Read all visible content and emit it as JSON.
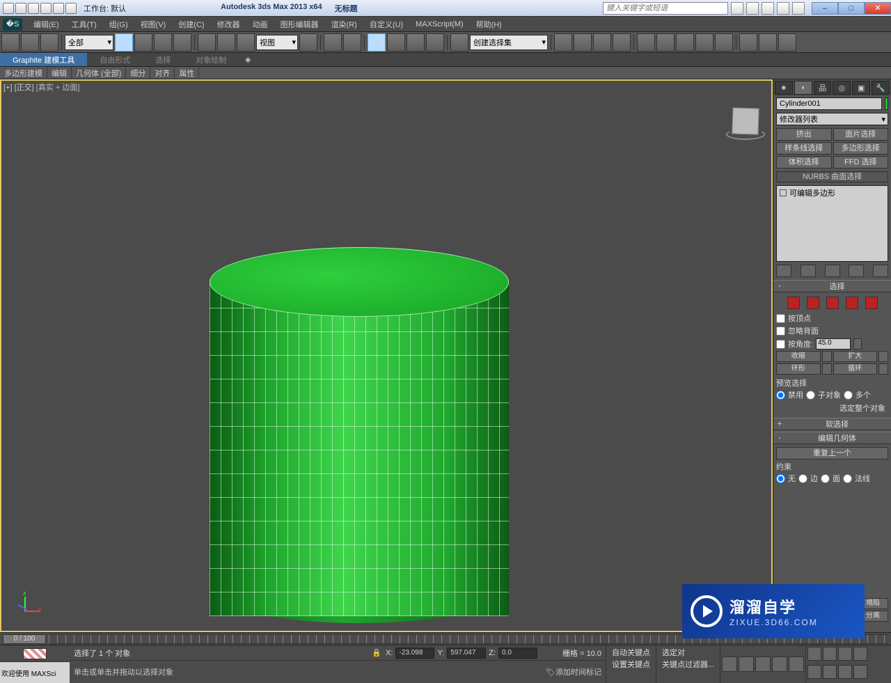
{
  "winbar": {
    "workspace_label": "工作台: 默认",
    "app_title": "Autodesk 3ds Max  2013 x64",
    "doc_title": "无标题",
    "search_placeholder": "键入关键字或短语",
    "btn_min": "–",
    "btn_max": "□",
    "btn_close": "✕"
  },
  "menu": {
    "items": [
      "编辑(E)",
      "工具(T)",
      "组(G)",
      "视图(V)",
      "创建(C)",
      "修改器",
      "动画",
      "图形编辑器",
      "渲染(R)",
      "自定义(U)",
      "MAXScript(M)",
      "帮助(H)"
    ]
  },
  "maintool": {
    "filter": "全部",
    "ref": "视图",
    "named_sel": "创建选择集"
  },
  "ribbon": {
    "tabs": [
      "Graphite 建模工具",
      "自由形式",
      "选择",
      "对象绘制"
    ],
    "sub": [
      "多边形建模",
      "编辑",
      "几何体 (全部)",
      "细分",
      "对齐",
      "属性"
    ]
  },
  "viewport": {
    "label_prefix": "[+] [正交]",
    "label_mode": "[真实 + 边面]"
  },
  "cmd": {
    "object_name": "Cylinder001",
    "modifier_list": "修改器列表",
    "mod_buttons": [
      "挤出",
      "面片选择",
      "样条线选择",
      "多边形选择",
      "体积选择",
      "FFD 选择"
    ],
    "nurbs_row": "NURBS 曲面选择",
    "stack_item": "可编辑多边形",
    "roll_select": "选择",
    "chk_byvertex": "按顶点",
    "chk_ignoreback": "忽略背面",
    "chk_byangle": "按角度:",
    "angle_value": "45.0",
    "btn_shrink": "收缩",
    "btn_grow": "扩大",
    "btn_ring": "环形",
    "btn_loop": "循环",
    "preview_sel": "预览选择",
    "r_off": "禁用",
    "r_subobj": "子对象",
    "r_multi": "多个",
    "sel_whole": "选定整个对象",
    "roll_soft": "软选择",
    "roll_editgeom": "编辑几何体",
    "repeat_last": "重复上一个",
    "constraint": "约束",
    "c_none": "无",
    "c_edge": "边",
    "c_face": "面",
    "c_normal": "法线",
    "extra1": "塌陷",
    "extra2": "分离"
  },
  "timeline": {
    "pos": "0 / 100"
  },
  "status": {
    "selected": "选择了 1 个 对象",
    "x": "-23.098",
    "y": "597.047",
    "z": "0.0",
    "grid": "栅格 = 10.0",
    "prompt": "单击或单击并拖动以选择对象",
    "autokey": "自动关键点",
    "setkey": "设置关键点",
    "sel_track": "选定对",
    "keyfilter": "关键点过滤器...",
    "addtime": "添加时间标记",
    "welcome": "欢迎使用  MAXSci"
  },
  "brand": {
    "a": "溜溜自学",
    "b": "ZIXUE.3D66.COM"
  },
  "colors": {
    "object": "#1fc52f"
  }
}
